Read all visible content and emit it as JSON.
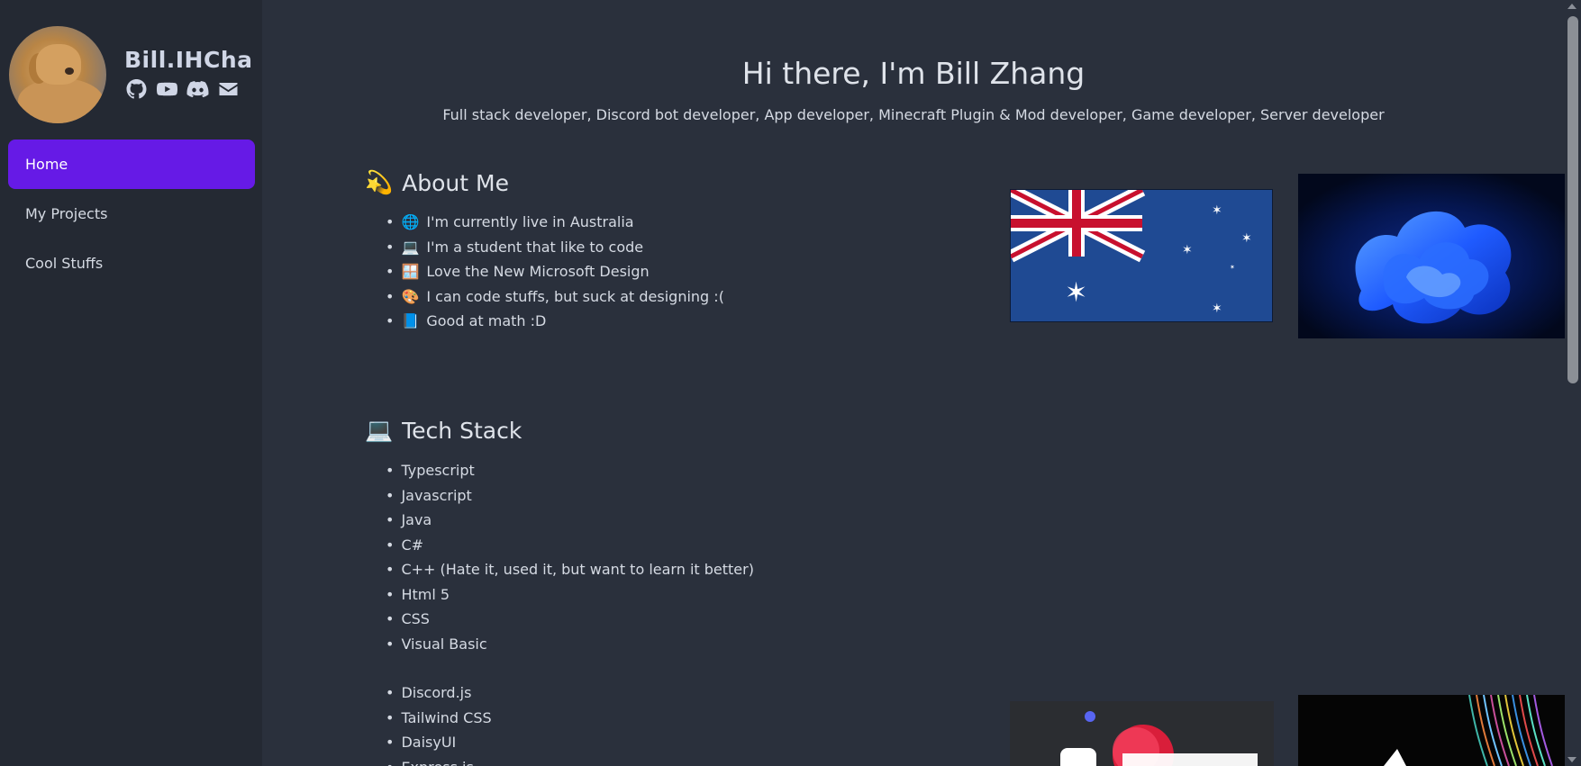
{
  "sidebar": {
    "name": "Bill.IHCha",
    "social_icons": [
      "github-icon",
      "youtube-icon",
      "discord-icon",
      "mail-icon"
    ],
    "nav": [
      {
        "label": "Home",
        "active": true
      },
      {
        "label": "My Projects",
        "active": false
      },
      {
        "label": "Cool Stuffs",
        "active": false
      }
    ]
  },
  "hero": {
    "title": "Hi there, I'm Bill Zhang",
    "subtitle": "Full stack developer, Discord bot developer, App developer, Minecraft Plugin & Mod developer, Game developer, Server developer"
  },
  "about": {
    "icon": "💫",
    "title": "About Me",
    "items": [
      {
        "icon": "🌐",
        "text": "I'm currently live in Australia"
      },
      {
        "icon": "💻",
        "text": "I'm a student that like to code"
      },
      {
        "icon": "🪟",
        "text": "Love the New Microsoft Design"
      },
      {
        "icon": "🎨",
        "text": "I can code stuffs, but suck at designing :("
      },
      {
        "icon": "📘",
        "text": "Good at math :D"
      }
    ]
  },
  "tech": {
    "icon": "💻",
    "title": "Tech Stack",
    "languages": [
      "Typescript",
      "Javascript",
      "Java",
      "C#",
      "C++ (Hate it, used it, but want to learn it better)",
      "Html 5",
      "CSS",
      "Visual Basic"
    ],
    "frameworks": [
      "Discord.js",
      "Tailwind CSS",
      "DaisyUI",
      "Express.js"
    ]
  },
  "colors": {
    "accent": "#661ae6",
    "background": "#2a303c",
    "sidebar": "#242933"
  }
}
